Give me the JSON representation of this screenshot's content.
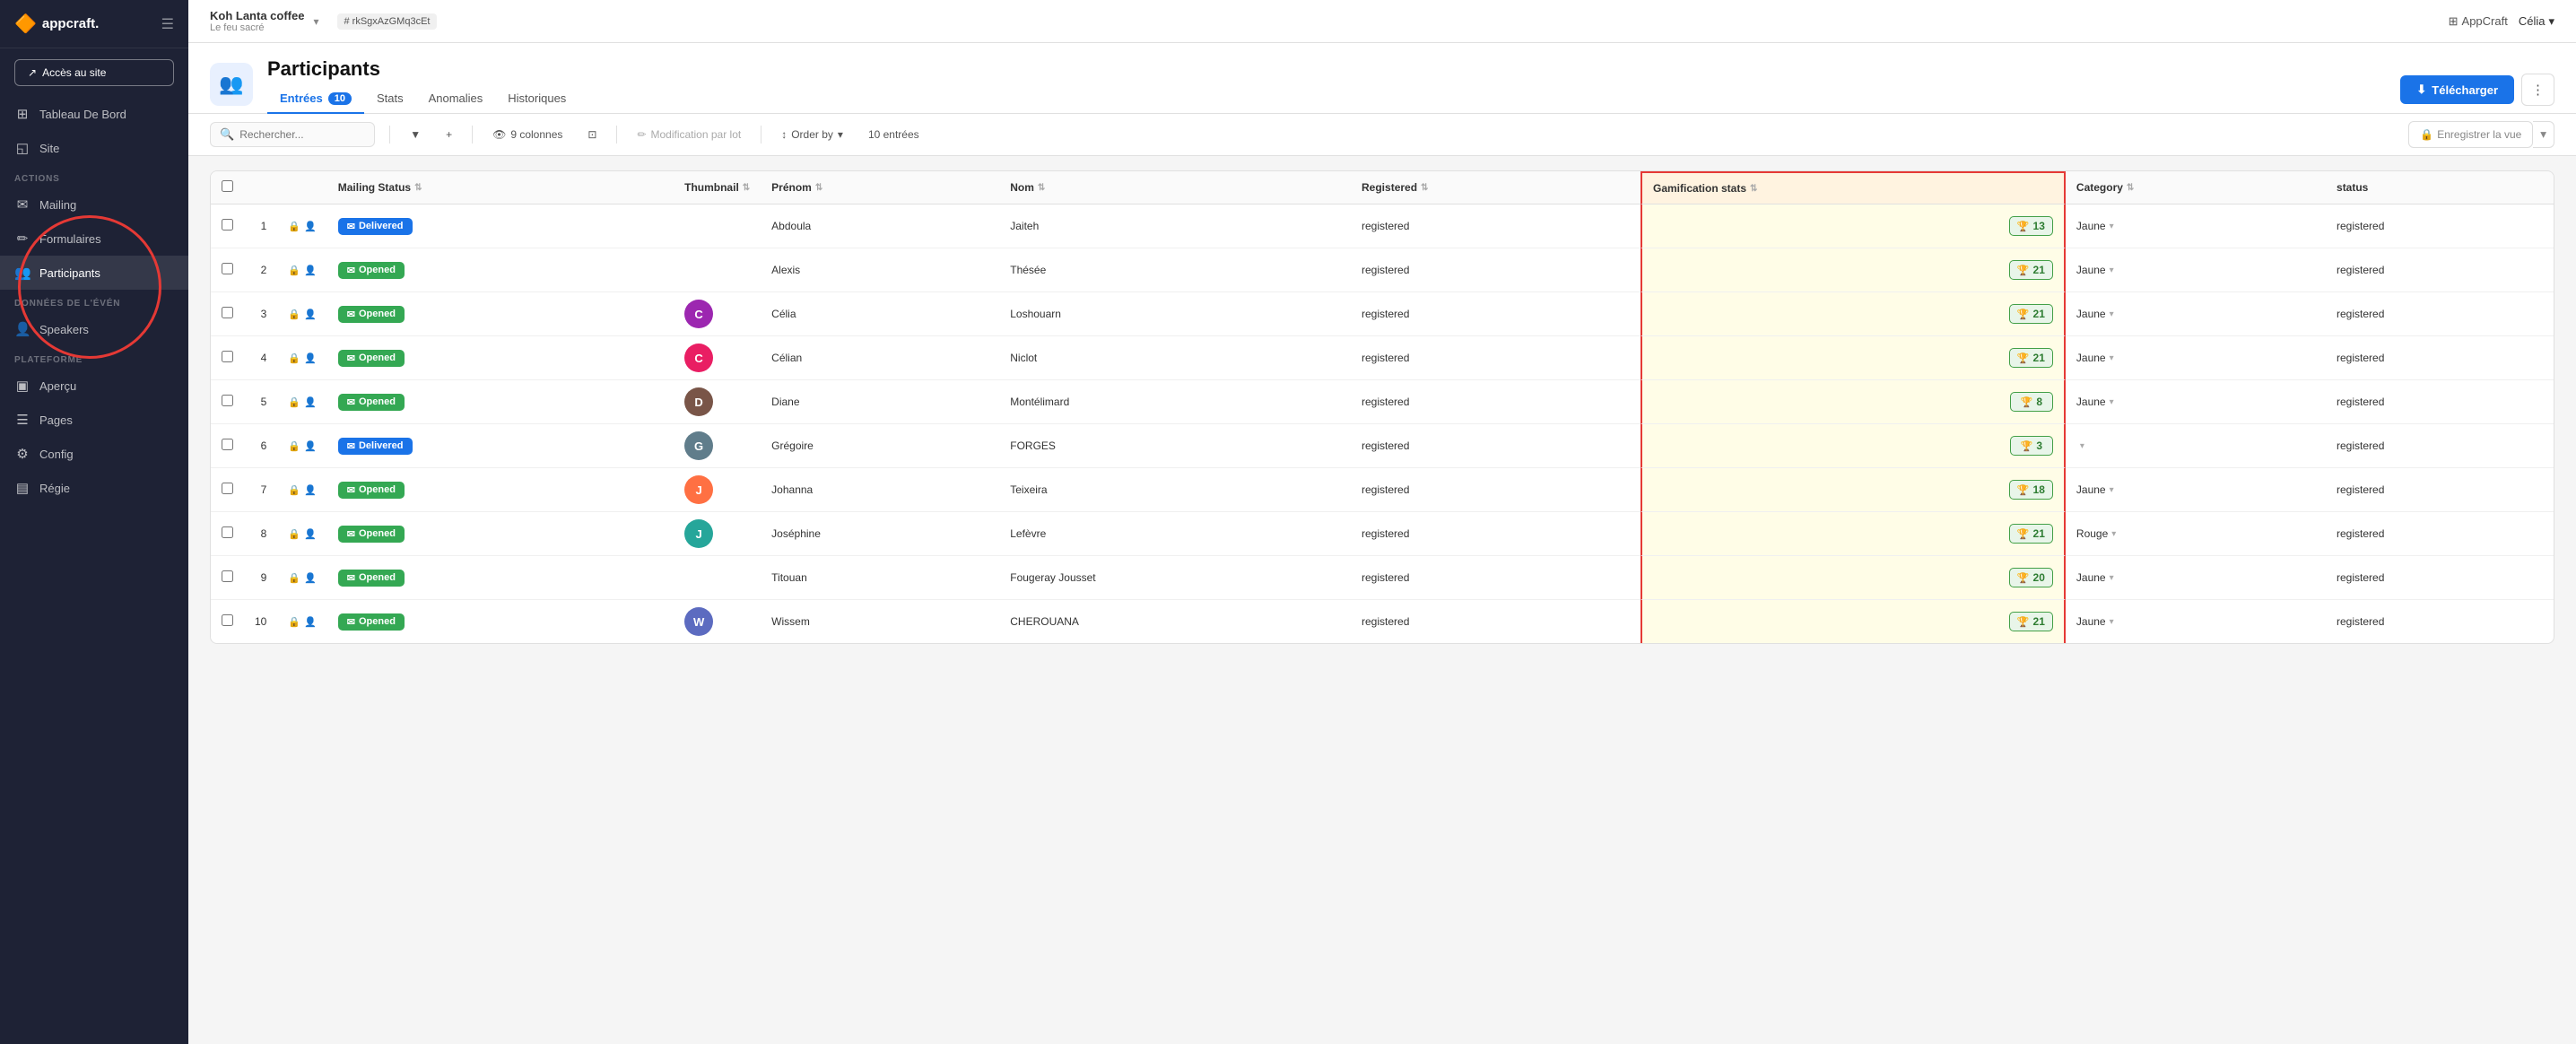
{
  "app": {
    "logo": "appcraft.",
    "logo_icon": "🔶"
  },
  "topbar": {
    "project_name": "Koh Lanta coffee",
    "project_subtitle": "Le feu sacré",
    "hash_id": "# rkSgxAzGMq3cEt",
    "appcraft_label": "AppCraft",
    "user_label": "Célia",
    "user_chevron": "▾"
  },
  "sidebar": {
    "access_btn": "Accès au site",
    "sections": [
      {
        "label": "",
        "items": [
          {
            "id": "tableau",
            "label": "Tableau De Bord",
            "icon": "⊞"
          },
          {
            "id": "site",
            "label": "Site",
            "icon": "◱"
          }
        ]
      },
      {
        "label": "ACTIONS",
        "items": [
          {
            "id": "mailing",
            "label": "Mailing",
            "icon": "✉"
          },
          {
            "id": "formulaires",
            "label": "Formulaires",
            "icon": "✏"
          },
          {
            "id": "participants",
            "label": "Participants",
            "icon": "👥",
            "active": true
          }
        ]
      },
      {
        "label": "DONNÉES DE L'ÉVÉN",
        "items": [
          {
            "id": "speakers",
            "label": "Speakers",
            "icon": "👤"
          }
        ]
      },
      {
        "label": "PLATEFORME",
        "items": [
          {
            "id": "apercu",
            "label": "Aperçu",
            "icon": "▣"
          },
          {
            "id": "pages",
            "label": "Pages",
            "icon": "☰"
          },
          {
            "id": "config",
            "label": "Config",
            "icon": "⚙"
          },
          {
            "id": "regie",
            "label": "Régie",
            "icon": "▤"
          }
        ]
      }
    ]
  },
  "page": {
    "icon": "👥",
    "title": "Participants",
    "tabs": [
      {
        "id": "entrees",
        "label": "Entrées",
        "badge": "10",
        "active": true
      },
      {
        "id": "stats",
        "label": "Stats",
        "badge": null
      },
      {
        "id": "anomalies",
        "label": "Anomalies",
        "badge": null
      },
      {
        "id": "historiques",
        "label": "Historiques",
        "badge": null
      }
    ],
    "download_btn": "Télécharger",
    "more_btn": "⋮"
  },
  "toolbar": {
    "search_placeholder": "Rechercher...",
    "filter_icon": "▼",
    "add_icon": "+",
    "columns_label": "9 colonnes",
    "frame_icon": "⊡",
    "bulk_label": "Modification par lot",
    "order_label": "Order by",
    "entries_label": "10 entrées",
    "save_view_label": "Enregistrer la vue"
  },
  "table": {
    "columns": [
      {
        "id": "checkbox",
        "label": ""
      },
      {
        "id": "num",
        "label": ""
      },
      {
        "id": "icons",
        "label": ""
      },
      {
        "id": "mailing_status",
        "label": "Mailing Status"
      },
      {
        "id": "thumbnail",
        "label": "Thumbnail"
      },
      {
        "id": "prenom",
        "label": "Prénom"
      },
      {
        "id": "nom",
        "label": "Nom"
      },
      {
        "id": "registered",
        "label": "Registered"
      },
      {
        "id": "gamification_stats",
        "label": "Gamification stats",
        "highlighted": true
      },
      {
        "id": "category",
        "label": "Category"
      },
      {
        "id": "status",
        "label": "status"
      }
    ],
    "rows": [
      {
        "num": "1",
        "mailing_status": "Delivered",
        "mailing_type": "delivered",
        "thumbnail": null,
        "thumbnail_color": null,
        "prenom": "Abdoula",
        "nom": "Jaiteh",
        "registered": "registered",
        "gamification": "13",
        "category": "Jaune",
        "status": "registered"
      },
      {
        "num": "2",
        "mailing_status": "Opened",
        "mailing_type": "opened",
        "thumbnail": null,
        "thumbnail_color": null,
        "prenom": "Alexis",
        "nom": "Thésée",
        "registered": "registered",
        "gamification": "21",
        "category": "Jaune",
        "status": "registered"
      },
      {
        "num": "3",
        "mailing_status": "Opened",
        "mailing_type": "opened",
        "thumbnail": "C",
        "thumbnail_color": "#9c27b0",
        "prenom": "Célia",
        "nom": "Loshouarn",
        "registered": "registered",
        "gamification": "21",
        "category": "Jaune",
        "status": "registered"
      },
      {
        "num": "4",
        "mailing_status": "Opened",
        "mailing_type": "opened",
        "thumbnail": "C",
        "thumbnail_color": "#e91e63",
        "prenom": "Célian",
        "nom": "Niclot",
        "registered": "registered",
        "gamification": "21",
        "category": "Jaune",
        "status": "registered"
      },
      {
        "num": "5",
        "mailing_status": "Opened",
        "mailing_type": "opened",
        "thumbnail": "D",
        "thumbnail_color": "#795548",
        "prenom": "Diane",
        "nom": "Montélimard",
        "registered": "registered",
        "gamification": "8",
        "category": "Jaune",
        "status": "registered"
      },
      {
        "num": "6",
        "mailing_status": "Delivered",
        "mailing_type": "delivered",
        "thumbnail": "G",
        "thumbnail_color": "#607d8b",
        "prenom": "Grégoire",
        "nom": "FORGES",
        "registered": "registered",
        "gamification": "3",
        "category": "",
        "status": "registered"
      },
      {
        "num": "7",
        "mailing_status": "Opened",
        "mailing_type": "opened",
        "thumbnail": "J",
        "thumbnail_color": "#ff7043",
        "prenom": "Johanna",
        "nom": "Teixeira",
        "registered": "registered",
        "gamification": "18",
        "category": "Jaune",
        "status": "registered"
      },
      {
        "num": "8",
        "mailing_status": "Opened",
        "mailing_type": "opened",
        "thumbnail": "J",
        "thumbnail_color": "#26a69a",
        "prenom": "Joséphine",
        "nom": "Lefèvre",
        "registered": "registered",
        "gamification": "21",
        "category": "Rouge",
        "status": "registered"
      },
      {
        "num": "9",
        "mailing_status": "Opened",
        "mailing_type": "opened",
        "thumbnail": null,
        "thumbnail_color": null,
        "prenom": "Titouan",
        "nom": "Fougeray Jousset",
        "registered": "registered",
        "gamification": "20",
        "category": "Jaune",
        "status": "registered"
      },
      {
        "num": "10",
        "mailing_status": "Opened",
        "mailing_type": "opened",
        "thumbnail": "W",
        "thumbnail_color": "#5c6bc0",
        "prenom": "Wissem",
        "nom": "CHEROUANA",
        "registered": "registered",
        "gamification": "21",
        "category": "Jaune",
        "status": "registered"
      }
    ]
  }
}
